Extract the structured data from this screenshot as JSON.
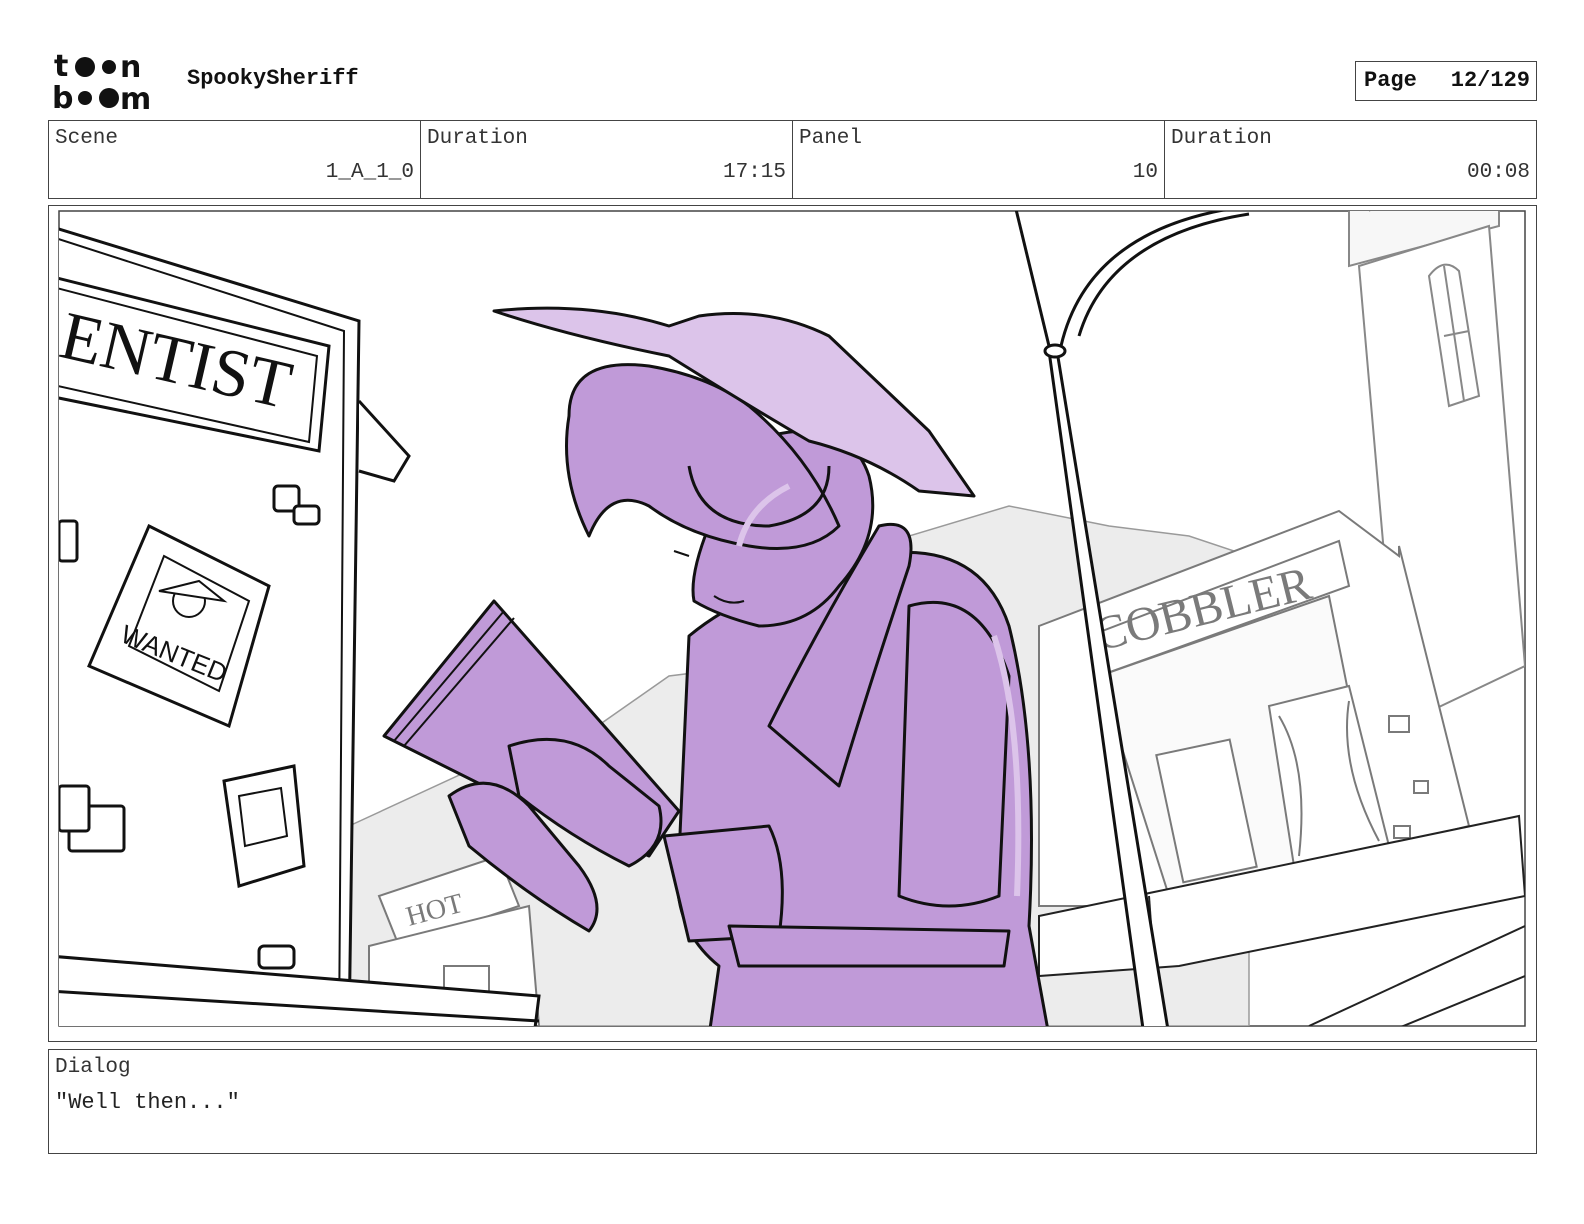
{
  "header": {
    "logo_text_top": "toon",
    "logo_text_bottom": "boom",
    "project": "SpookySheriff",
    "page_label": "Page",
    "page_value": "12/129"
  },
  "info": {
    "scene_label": "Scene",
    "scene_value": "1_A_1_0",
    "scene_duration_label": "Duration",
    "scene_duration_value": "17:15",
    "panel_label": "Panel",
    "panel_value": "10",
    "panel_duration_label": "Duration",
    "panel_duration_value": "00:08"
  },
  "artwork": {
    "signs": {
      "dentist": "ENTIST",
      "wanted": "WANTED",
      "cobbler": "COBBLER",
      "hotel": "HOT"
    },
    "colors": {
      "character_fill": "#c09ad8",
      "character_highlight": "#dcc4ea",
      "line": "#111111",
      "background_line": "#8a8a8a",
      "background_fill": "#ececec"
    }
  },
  "dialog": {
    "label": "Dialog",
    "text": "\"Well then...\""
  }
}
